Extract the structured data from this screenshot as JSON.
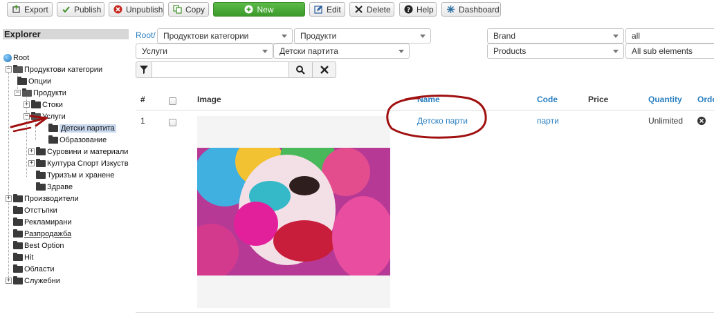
{
  "toolbar": {
    "export": "Export",
    "publish": "Publish",
    "unpublish": "Unpublish",
    "copy": "Copy",
    "new": "New",
    "edit": "Edit",
    "delete": "Delete",
    "help": "Help",
    "dashboard": "Dashboard"
  },
  "explorer": {
    "title": "Explorer",
    "root": "Root",
    "items": [
      "Продуктови категории",
      "Опции",
      "Продукти",
      "Стоки",
      "Услуги",
      "Детски партита",
      "Образование",
      "Суровини и материали",
      "Култура Спорт Изкуства",
      "Туризъм и хранене",
      "Здраве",
      "Производители",
      "Отстъпки",
      "Рекламирани",
      "Разпродажба",
      "Best Option",
      "Hit",
      "Области",
      "Служебни"
    ]
  },
  "filters": {
    "breadcrumb_root": "Root/",
    "dd1": "Продуктови категории",
    "dd2": "Продукти",
    "dd3": "Услуги",
    "dd4": "Детски партита",
    "brand": "Brand",
    "brand_value": "all",
    "products": "Products",
    "sub_elements": "All sub elements"
  },
  "table": {
    "headers": {
      "num": "#",
      "image": "Image",
      "name": "Name",
      "code": "Code",
      "price": "Price",
      "quantity": "Quantity",
      "order": "Order"
    },
    "rows": [
      {
        "num": "1",
        "name": "Детско парти",
        "code": "парти",
        "price": "",
        "quantity": "Unlimited"
      }
    ]
  },
  "colors": {
    "accent": "#2a7fc0",
    "new_button": "#4cae3a",
    "annotation": "#a01010"
  }
}
